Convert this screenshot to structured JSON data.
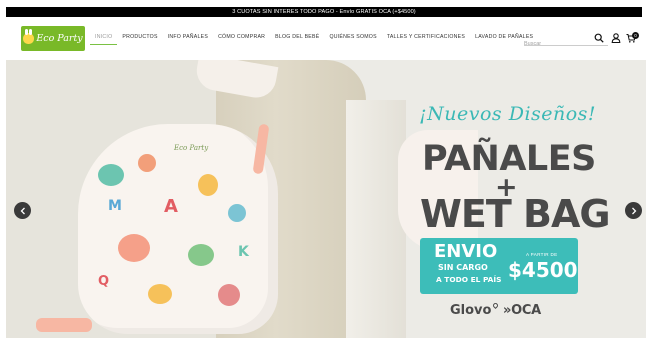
{
  "promo_bar": {
    "text": "3 CUOTAS SIN INTERES TODO PAGO - Envío GRATIS OCA (+$4500)"
  },
  "header": {
    "logo_text": "Eco Party",
    "nav": [
      {
        "label": "INICIO",
        "active": true
      },
      {
        "label": "PRODUCTOS"
      },
      {
        "label": "INFO PAÑALES"
      },
      {
        "label": "CÓMO COMPRAR"
      },
      {
        "label": "BLOG DEL BEBÉ"
      },
      {
        "label": "QUIÉNES SOMOS"
      },
      {
        "label": "TALLES Y CERTIFICACIONES"
      },
      {
        "label": "LAVADO DE PAÑALES"
      }
    ],
    "search_placeholder": "Buscar",
    "cart_count": "0",
    "icons": {
      "search": "search-icon",
      "account": "user-icon",
      "cart": "cart-icon"
    }
  },
  "hero": {
    "tagline": "¡Nuevos Diseños!",
    "headline_1": "PAÑALES",
    "headline_2": "+",
    "headline_3": "WET BAG",
    "shipping": {
      "title": "ENVIO",
      "line_1": "SIN CARGO",
      "line_2": "A TODO EL PAÍS",
      "from_label": "A PARTIR DE",
      "price": "$4500"
    },
    "partners": [
      "Glovo",
      "»OCA"
    ],
    "diaper_brand": "Eco Party",
    "colors": {
      "teal": "#3dbdb9",
      "dark_text": "#4a4a4a",
      "logo_green": "#79b928"
    },
    "arrows": {
      "prev": "chevron-left-icon",
      "next": "chevron-right-icon"
    }
  }
}
